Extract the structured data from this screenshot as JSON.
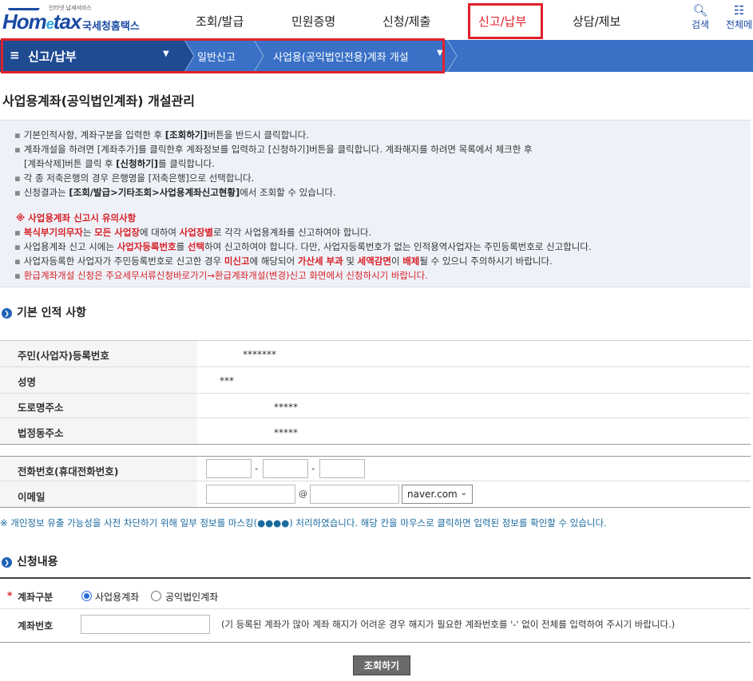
{
  "header": {
    "logo_tag": "인터넷 납세서비스",
    "logo_brand_a": "Hom",
    "logo_brand_e": "e",
    "logo_brand_b": "tax",
    "logo_ko": "국세청홈택스",
    "nav": [
      "조회/발급",
      "민원증명",
      "신청/제출",
      "신고/납부",
      "상담/제보"
    ],
    "active_nav": "신고/납부",
    "search_label": "검색",
    "all_label": "전체메"
  },
  "subnav": {
    "menu_label": "신고/납부",
    "crumbs": [
      "일반신고",
      "사업용(공익법인전용)계좌 개설"
    ]
  },
  "page": {
    "title": "사업용계좌(공익법인계좌) 개설관리"
  },
  "info": {
    "l1a": "기본인적사항, 계좌구분을 입력한 후 ",
    "l1b": "[조회하기]",
    "l1c": "버튼을 반드시 클릭합니다.",
    "l2": "계좌개설을 하려면 [계좌추가]를 클릭한후 계좌정보를 입력하고 [신청하기]버튼을 클릭합니다. 계좌해지를 하려면 목록에서 체크한 후",
    "l3a": "[계좌삭제]버튼 클릭 후 ",
    "l3b": "[신청하기]",
    "l3c": "를 클릭합니다.",
    "l4": "각 종 저축은행의 경우 은행명을 [저축은행]으로 선택합니다.",
    "l5a": "신청결과는 ",
    "l5b": "[조회/발급>기타조회>사업용계좌신고현황]",
    "l5c": "에서 조회할 수 있습니다.",
    "warn_title": "※ 사업용계좌 신고시 유의사항",
    "w1a": "복식부기의무자",
    "w1b": "는 ",
    "w1c": "모든 사업장",
    "w1d": "에 대하여 ",
    "w1e": "사업장별",
    "w1f": "로 각각 사업용계좌를 신고하여야 합니다.",
    "w2a": "사업용계좌 신고 시에는 ",
    "w2b": "사업자등록번호",
    "w2c": "를 ",
    "w2d": "선택",
    "w2e": "하여 신고하여야 합니다. 다만, 사업자등록번호가 없는 인적용역사업자는 주민등록번호로 신고합니다.",
    "w3a": "사업자등록한 사업자가 주민등록번호로 신고한 경우 ",
    "w3b": "미신고",
    "w3c": "에 해당되어 ",
    "w3d": "가산세 부과",
    "w3e": " 및 ",
    "w3f": "세액감면",
    "w3g": "이 ",
    "w3h": "배제",
    "w3i": "될 수 있으니 주의하시기 바랍니다.",
    "w4": "환급계좌개설 신청은 주요세무서류신청바로가기→환급계좌개설(변경)신고 화면에서 신청하시기 바랍니다."
  },
  "basic": {
    "section_title": "기본 인적 사항",
    "rows": [
      {
        "label": "주민(사업자)등록번호",
        "value": "*******"
      },
      {
        "label": "성명",
        "value": "***"
      },
      {
        "label": "도로명주소",
        "value": "*****"
      },
      {
        "label": "법정동주소",
        "value": "*****"
      }
    ],
    "phone_label": "전화번호(휴대전화번호)",
    "email_label": "이메일",
    "dash": "-",
    "at": "@",
    "email_domain": "naver.com"
  },
  "notice": "※ 개인정보 유출 가능성을 사전 차단하기 위해 일부 정보를 마스킹(●●●●) 처리하였습니다. 해당 칸을 마우스로 클릭하면 입력된 정보를 확인할 수 있습니다.",
  "apply": {
    "section_title": "신청내용",
    "account_type_label": "계좌구분",
    "required_mark": "*",
    "option1": "사업용계좌",
    "option2": "공익법인계좌",
    "account_no_label": "계좌번호",
    "account_hint": "(기 등록된 계좌가 많아 계좌 해지가 어려운 경우 해지가 필요한 계좌번호를 '-' 없이 전체를 입력하여 주시기 바랍니다.)",
    "submit": "조회하기"
  }
}
